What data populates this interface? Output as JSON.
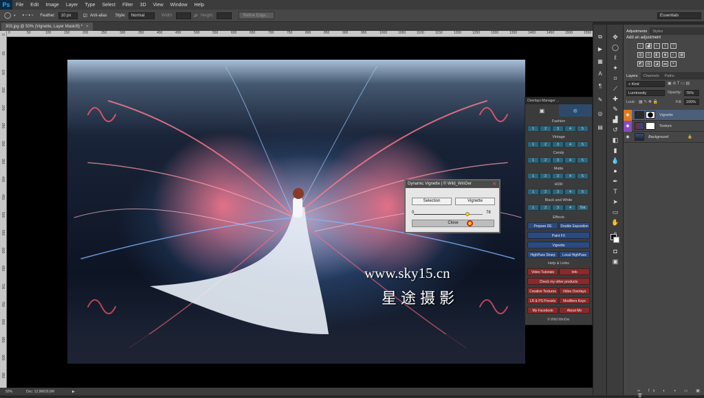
{
  "app": {
    "logo": "Ps"
  },
  "menu": [
    "File",
    "Edit",
    "Image",
    "Layer",
    "Type",
    "Select",
    "Filter",
    "3D",
    "View",
    "Window",
    "Help"
  ],
  "options": {
    "feather_label": "Feather:",
    "feather_value": "10 px",
    "antialias_label": "Anti-alias",
    "style_label": "Style:",
    "style_value": "Normal",
    "width_label": "Width:",
    "height_label": "Height:",
    "refine_label": "Refine Edge...",
    "workspace": "Essentials"
  },
  "document": {
    "tab_title": "303.jpg @ 50% (Vignette, Layer Mask/8) *",
    "ruler_h": [
      "0",
      "50",
      "100",
      "150",
      "200",
      "250",
      "300",
      "350",
      "400",
      "450",
      "500",
      "550",
      "600",
      "650",
      "700",
      "750",
      "800",
      "850",
      "900",
      "950",
      "1000",
      "1050",
      "1100",
      "1150",
      "1200",
      "1250",
      "1300",
      "1350",
      "1400",
      "1450",
      "1500",
      "1550"
    ],
    "ruler_v": [
      "0",
      "50",
      "100",
      "150",
      "200",
      "250",
      "300",
      "350",
      "400",
      "450",
      "500",
      "550",
      "600",
      "650",
      "700",
      "750",
      "800",
      "850",
      "900",
      "950"
    ]
  },
  "status": {
    "zoom": "50%",
    "doc": "Doc: 12,9M/29,9M"
  },
  "panels": {
    "top_tabs": [
      "Adjustments",
      "Styles"
    ],
    "adjustment_header": "Add an adjustment",
    "layers_tabs": [
      "Layers",
      "Channels",
      "Paths"
    ],
    "kind_label": "Kind",
    "blend_mode": "Luminosity",
    "opacity_label": "Opacity:",
    "opacity_value": "76%",
    "lock_label": "Lock:",
    "fill_label": "Fill:",
    "fill_value": "100%",
    "layers": [
      {
        "name": "Vignette"
      },
      {
        "name": "Texture"
      },
      {
        "name": "Background"
      }
    ]
  },
  "overlays": {
    "title": "Overlays Manager ...",
    "rows": [
      {
        "label": "Fashion",
        "nums": [
          "1",
          "2",
          "3",
          "4",
          "5"
        ]
      },
      {
        "label": "Vintage",
        "nums": [
          "1",
          "2",
          "3",
          "4",
          "5"
        ]
      },
      {
        "label": "Candy",
        "nums": [
          "1",
          "2",
          "3",
          "4",
          "5"
        ]
      },
      {
        "label": "Matte",
        "nums": [
          "1",
          "2",
          "3",
          "4",
          "5"
        ]
      },
      {
        "label": "HDR",
        "nums": [
          "1",
          "2",
          "3",
          "4",
          "5"
        ]
      },
      {
        "label": "Black and White",
        "nums": [
          "1",
          "2",
          "3",
          "4",
          "Tint"
        ]
      }
    ],
    "effects_label": "Effects",
    "prepare_de": "Prepare DE",
    "double_exposition": "Double Exposition",
    "paint_fx": "Paint FX",
    "vignette": "Vignette",
    "highpass_sharp": "HighPass Sharp",
    "local_highpass": "Local HighPass",
    "help_label": "Help & Links",
    "video_tutorials": "Video Tutorials",
    "info": "Info",
    "check_products": "Check my other products",
    "creative_textures": "Creative Textures",
    "video_overlays": "Video Overlays",
    "lr_presets": "LR & PS Presets",
    "modifiers_keys": "Modifiers Keys",
    "my_facebook": "My Facebook",
    "about_me": "About Me",
    "copyright": "© Wild WinDer"
  },
  "dialog": {
    "title": "Dynamic Vignette | © Wild_WinDer",
    "selection": "Selection",
    "vignette": "Vignette",
    "min": "0",
    "value": "78",
    "slider_fraction": 0.78,
    "close": "Close"
  },
  "watermark": {
    "url": "www.sky15.cn",
    "cn": "星途摄影"
  }
}
